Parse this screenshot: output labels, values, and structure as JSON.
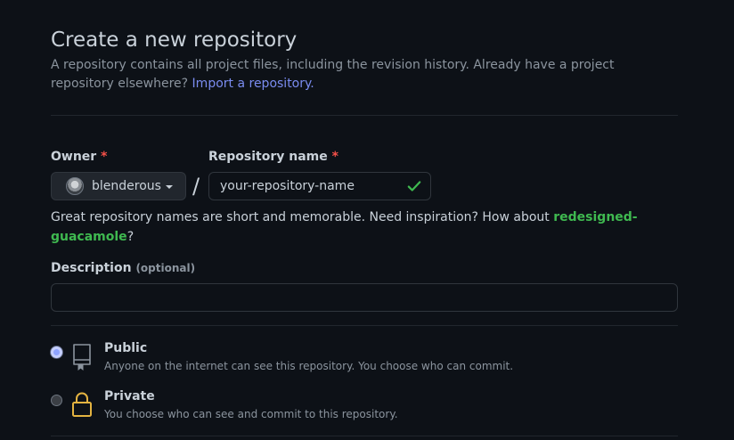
{
  "header": {
    "title": "Create a new repository",
    "subtitle": "A repository contains all project files, including the revision history. Already have a project repository elsewhere?",
    "import_link": "Import a repository."
  },
  "owner": {
    "label": "Owner",
    "required_mark": "*",
    "value": "blenderous",
    "avatar_icon": "user-avatar"
  },
  "separator": "/",
  "repo_name": {
    "label": "Repository name",
    "required_mark": "*",
    "value": "your-repository-name",
    "status_icon": "check-icon",
    "status_color": "#3fb950"
  },
  "hint": {
    "text": "Great repository names are short and memorable. Need inspiration? How about",
    "suggestion": "redesigned-guacamole",
    "suffix": "?"
  },
  "description": {
    "label": "Description",
    "optional": "(optional)",
    "value": ""
  },
  "visibility": [
    {
      "title": "Public",
      "description": "Anyone on the internet can see this repository. You choose who can commit.",
      "icon": "repo-icon",
      "selected": true
    },
    {
      "title": "Private",
      "description": "You choose who can see and commit to this repository.",
      "icon": "lock-icon",
      "selected": false
    }
  ],
  "colors": {
    "background": "#0d1117",
    "text": "#c9d1d9",
    "muted": "#8b949e",
    "link": "#7a8cf0",
    "required": "#f85149",
    "success": "#3fb950",
    "lock": "#e3b341"
  }
}
